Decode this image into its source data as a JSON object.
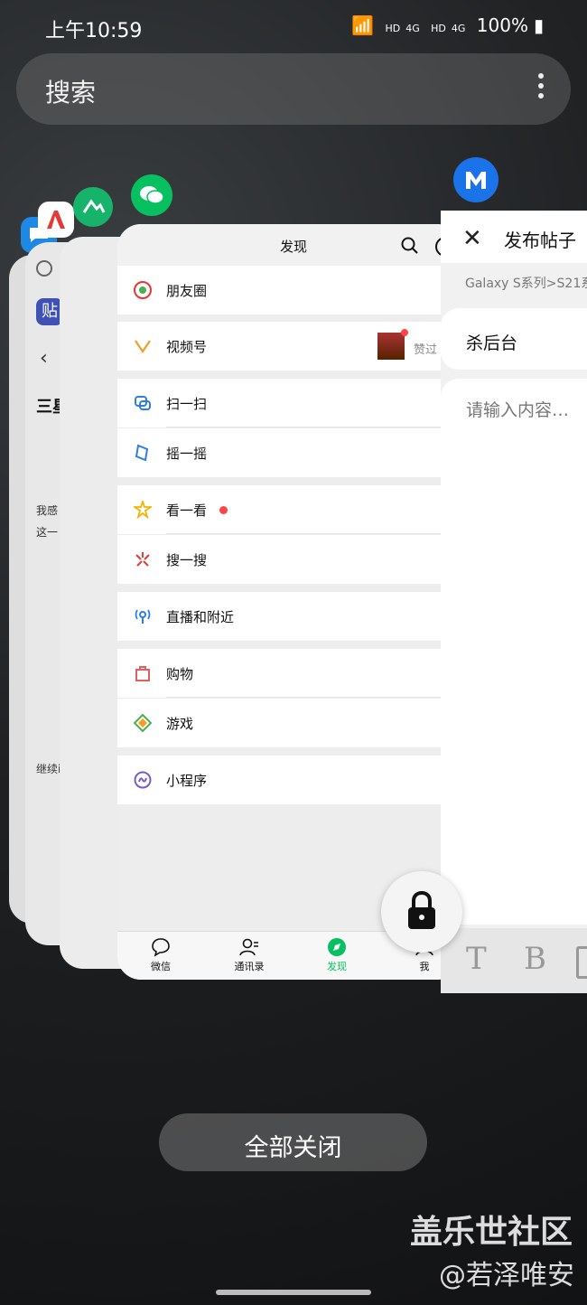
{
  "status_bar": {
    "time": "上午10:59",
    "hd1": "HD",
    "net1": "4G",
    "hd2": "HD",
    "net2": "4G",
    "battery": "100%"
  },
  "search": {
    "label": "搜索"
  },
  "apps": {
    "wechat_card": {
      "title": "发现",
      "items": [
        {
          "label": "朋友圈"
        },
        {
          "label": "视频号",
          "extra": "赞过"
        },
        {
          "label": "扫一扫"
        },
        {
          "label": "摇一摇"
        },
        {
          "label": "看一看"
        },
        {
          "label": "搜一搜"
        },
        {
          "label": "直播和附近"
        },
        {
          "label": "购物"
        },
        {
          "label": "游戏"
        },
        {
          "label": "小程序"
        }
      ],
      "tabs": [
        "微信",
        "通讯录",
        "发现",
        "我"
      ]
    },
    "post_card": {
      "title": "发布帖子",
      "breadcrumb": "Galaxy S系列>S21系",
      "title_value": "杀后台",
      "content_placeholder": "请输入内容…",
      "tools": [
        "T",
        "B"
      ]
    },
    "back_card": {
      "heading": "三星",
      "text1": "我感",
      "text2": "这一",
      "text3": "继续i"
    }
  },
  "close_all": "全部关闭",
  "watermark": {
    "line1": "盖乐世社区",
    "line2": "@若泽唯安"
  },
  "colors": {
    "wechat_green": "#07c160",
    "wechat_bg": "#ededed"
  }
}
